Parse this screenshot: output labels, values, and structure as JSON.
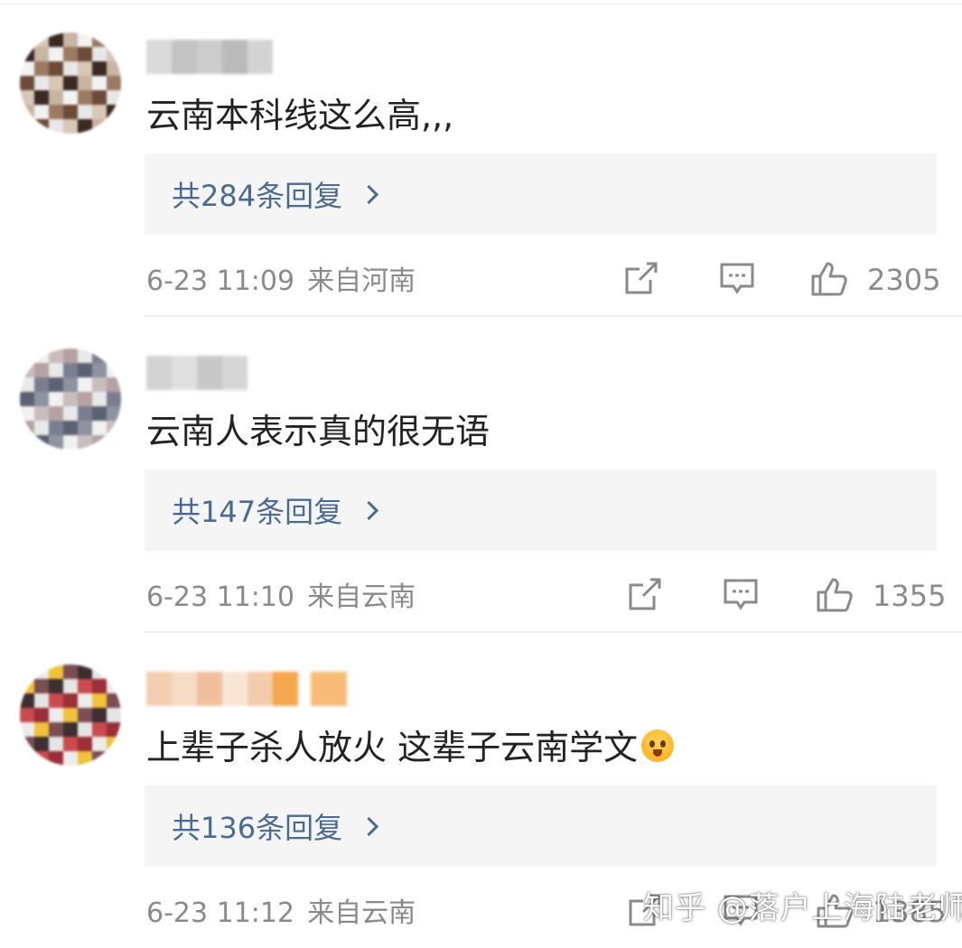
{
  "comments": [
    {
      "text": "云南本科线这么高,,,",
      "replies": "共284条回复",
      "time": "6-23 11:09",
      "location": "来自河南",
      "likes": "2305",
      "avatar_colors": [
        "#e8e8e8",
        "#c9b4a3",
        "#6d4b3a",
        "#3a2a22",
        "#9c7a62",
        "#d9c6b7",
        "#f2f2f2"
      ],
      "name_colors": [
        "#d6d6d6",
        "#bdbdbd",
        "#c7c7c7",
        "#b3b3b3",
        "#cfcfcf"
      ]
    },
    {
      "text": "云南人表示真的很无语",
      "replies": "共147条回复",
      "time": "6-23 11:10",
      "location": "来自云南",
      "likes": "1355",
      "avatar_colors": [
        "#e9e9ea",
        "#8d93a1",
        "#b6a2a3",
        "#5c6272",
        "#c9bcbd",
        "#7a7f8f",
        "#f1f1f1"
      ],
      "name_colors": [
        "#cfcfcf",
        "#dcdcdc",
        "#c3c3c3",
        "#d2d2d2"
      ]
    },
    {
      "text": "上辈子杀人放火 这辈子云南学文",
      "emoji": "scream-emoji",
      "replies": "共136条回复",
      "time": "6-23 11:12",
      "location": "来自云南",
      "likes": "1385",
      "avatar_colors": [
        "#ececec",
        "#3b2f30",
        "#9a2f37",
        "#7a4e52",
        "#c94a4f",
        "#f2c23a",
        "#e5e5e5"
      ],
      "name_colors": [
        "#f3c9a8",
        "#f6d8bf",
        "#f0b994",
        "#f8e3d2",
        "#f2c7a3",
        "#f59d3c",
        "#f7b567"
      ]
    }
  ],
  "watermark": "知乎 @落户上海陆老师",
  "icons": {
    "share": "share-icon",
    "comment": "comment-icon",
    "like": "thumbs-up-icon",
    "more": "chevron-right-icon"
  }
}
